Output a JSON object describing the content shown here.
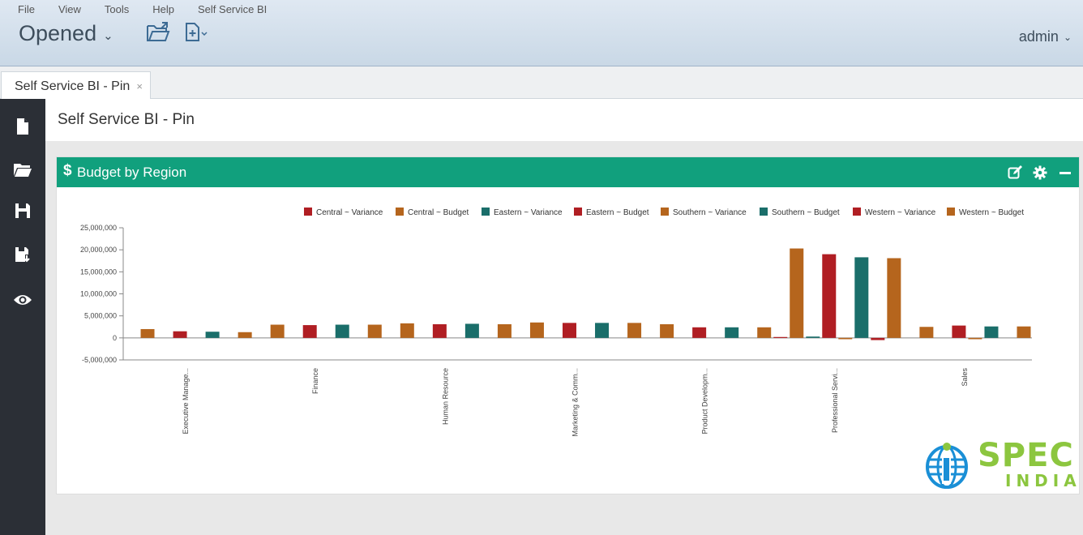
{
  "menu": {
    "items": [
      "File",
      "View",
      "Tools",
      "Help",
      "Self Service BI"
    ]
  },
  "header": {
    "workspace": "Opened",
    "user": "admin"
  },
  "tabs": [
    {
      "label": "Self Service BI - Pin",
      "close": "×"
    }
  ],
  "page": {
    "title": "Self Service BI - Pin"
  },
  "panel": {
    "title": "Budget by Region",
    "icon_text": "$"
  },
  "logo": {
    "brand": "SPEC",
    "sub": "INDIA"
  },
  "colors": {
    "accent": "#11a07d",
    "sidebar": "#2b2f36",
    "red": "#b01e23",
    "orange": "#b5651d",
    "teal": "#1a6e6a"
  },
  "icons": [
    "folder-open-icon",
    "new-file-icon",
    "document-icon",
    "folder-icon",
    "save-icon",
    "save-as-icon",
    "eye-icon",
    "edit-icon",
    "gear-icon",
    "minimize-icon"
  ],
  "chart_data": {
    "type": "bar",
    "title": "",
    "xlabel": "",
    "ylabel": "",
    "ylim": [
      -5000000,
      25000000
    ],
    "yticks": [
      "25,000,000",
      "20,000,000",
      "15,000,000",
      "10,000,000",
      "5,000,000",
      "0",
      "-5,000,000"
    ],
    "legend_position": "top-right",
    "categories": [
      "Executive Manage...",
      "Finance",
      "Human Resource",
      "Marketing & Comm...",
      "Product Developm...",
      "Professional Servi...",
      "Sales"
    ],
    "series": [
      {
        "name": "Central ~ Variance",
        "color": "#b01e23",
        "values": [
          0,
          0,
          0,
          0,
          0,
          200000,
          0
        ]
      },
      {
        "name": "Central ~ Budget",
        "color": "#b5651d",
        "values": [
          2000000,
          3000000,
          3300000,
          3500000,
          3100000,
          20300000,
          2500000
        ]
      },
      {
        "name": "Eastern ~ Variance",
        "color": "#1a6e6a",
        "values": [
          0,
          0,
          0,
          0,
          0,
          300000,
          0
        ]
      },
      {
        "name": "Eastern ~ Budget",
        "color": "#b01e23",
        "values": [
          1500000,
          2900000,
          3100000,
          3400000,
          2400000,
          19000000,
          2800000
        ]
      },
      {
        "name": "Southern ~ Variance",
        "color": "#b5651d",
        "values": [
          0,
          0,
          0,
          0,
          0,
          -300000,
          -300000
        ]
      },
      {
        "name": "Southern ~ Budget",
        "color": "#1a6e6a",
        "values": [
          1400000,
          3000000,
          3200000,
          3400000,
          2400000,
          18300000,
          2600000
        ]
      },
      {
        "name": "Western ~ Variance",
        "color": "#b01e23",
        "values": [
          0,
          0,
          0,
          0,
          0,
          -500000,
          0
        ]
      },
      {
        "name": "Western ~ Budget",
        "color": "#b5651d",
        "values": [
          1300000,
          3000000,
          3100000,
          3400000,
          2400000,
          18100000,
          2600000
        ]
      }
    ]
  }
}
